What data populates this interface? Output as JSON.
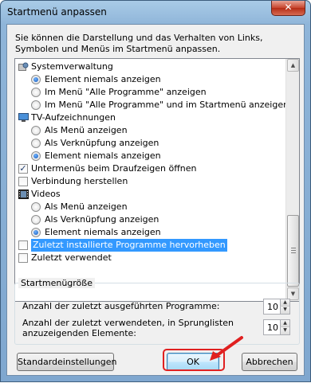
{
  "window": {
    "title": "Startmenü anpassen",
    "close_symbol": "✕"
  },
  "description": "Sie können die Darstellung und das Verhalten von Links, Symbolen und Menüs im Startmenü anpassen.",
  "list": {
    "rows": [
      {
        "kind": "category",
        "icon": "admin-tools-icon",
        "label": "Systemverwaltung"
      },
      {
        "kind": "radio",
        "checked": true,
        "label": "Element niemals anzeigen"
      },
      {
        "kind": "radio",
        "checked": false,
        "label": "Im Menü \"Alle Programme\" anzeigen"
      },
      {
        "kind": "radio",
        "checked": false,
        "label": "Im Menü \"Alle Programme\" und im Startmenü anzeigen"
      },
      {
        "kind": "category",
        "icon": "tv-icon",
        "label": "TV-Aufzeichnungen"
      },
      {
        "kind": "radio",
        "checked": false,
        "label": "Als Menü anzeigen"
      },
      {
        "kind": "radio",
        "checked": false,
        "label": "Als Verknüpfung anzeigen"
      },
      {
        "kind": "radio",
        "checked": true,
        "label": "Element niemals anzeigen"
      },
      {
        "kind": "check",
        "checked": true,
        "label": "Untermenüs beim Draufzeigen öffnen"
      },
      {
        "kind": "check",
        "checked": false,
        "label": "Verbindung herstellen"
      },
      {
        "kind": "category",
        "icon": "video-icon",
        "label": "Videos"
      },
      {
        "kind": "radio",
        "checked": false,
        "label": "Als Menü anzeigen"
      },
      {
        "kind": "radio",
        "checked": false,
        "label": "Als Verknüpfung anzeigen"
      },
      {
        "kind": "radio",
        "checked": true,
        "label": "Element niemals anzeigen"
      },
      {
        "kind": "check",
        "checked": false,
        "selected": true,
        "label": "Zuletzt installierte Programme hervorheben"
      },
      {
        "kind": "check",
        "checked": false,
        "label": "Zuletzt verwendet"
      }
    ]
  },
  "group": {
    "label": "Startmenügröße",
    "recent_programs_label": "Anzahl der zuletzt ausgeführten Programme:",
    "recent_programs_value": "10",
    "jumplist_label_line1": "Anzahl der zuletzt verwendeten, in Sprunglisten",
    "jumplist_label_line2": "anzuzeigenden Elemente:",
    "jumplist_value": "10"
  },
  "buttons": {
    "defaults": "Standardeinstellungen",
    "ok": "OK",
    "cancel": "Abbrechen"
  },
  "annotation_color": "#e02020"
}
